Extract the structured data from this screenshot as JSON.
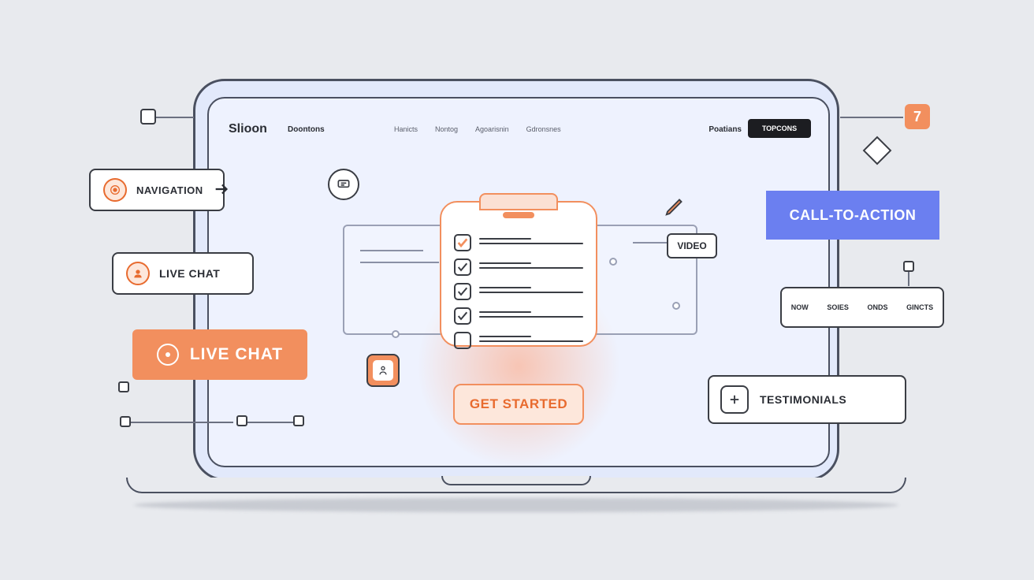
{
  "header": {
    "brand": "Slioon",
    "brand_sub": "Doontons",
    "nav": [
      "Hanicts",
      "Nontog",
      "Agoarisnin",
      "Gdronsnes"
    ],
    "right_text": "Poatians",
    "button": "TOPCONS"
  },
  "callouts": {
    "navigation": "NAVIGATION",
    "live_chat_small": "LIVE CHAT",
    "live_chat_big": "LIVE CHAT",
    "cta": "CALL-TO-ACTION",
    "video": "VIDEO",
    "testimonials": "TESTIMONIALS",
    "get_started": "GET STARTED"
  },
  "mini_tabs": [
    "NOW",
    "SOIES",
    "ONDS",
    "GINCTS"
  ],
  "orange_badge": "7"
}
